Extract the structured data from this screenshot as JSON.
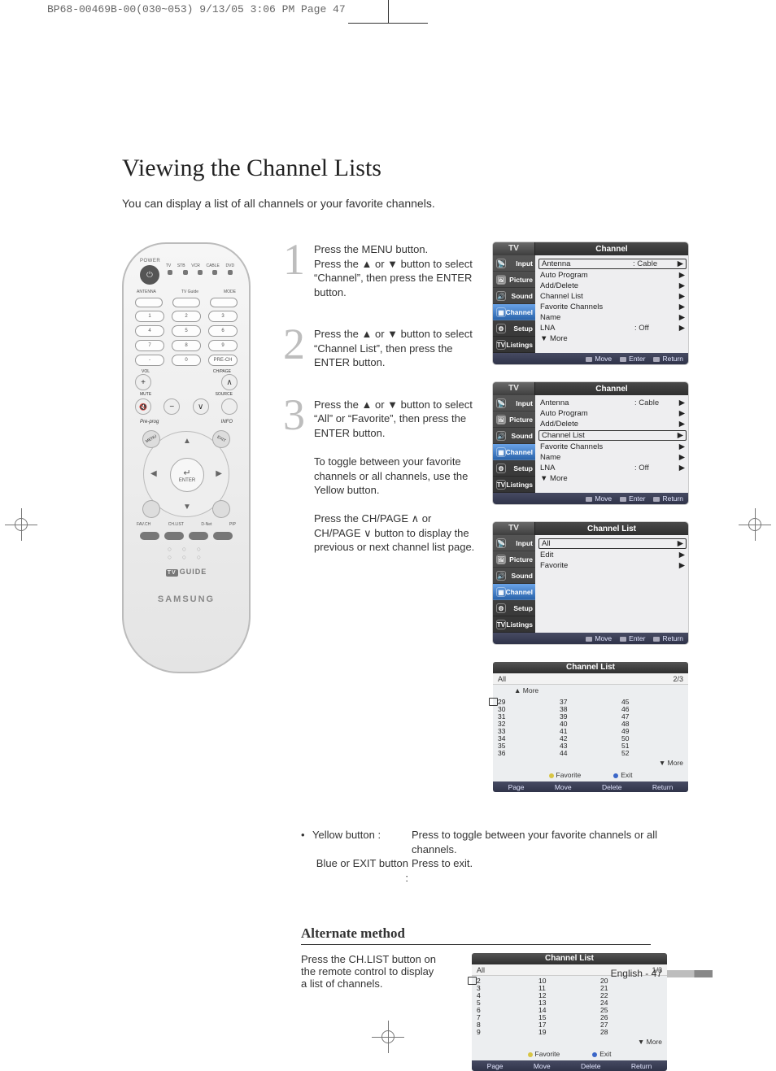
{
  "print_header": "BP68-00469B-00(030~053)  9/13/05  3:06 PM  Page 47",
  "title": "Viewing the Channel Lists",
  "intro": "You can display a list of all channels or your favorite channels.",
  "remote": {
    "power_label": "POWER",
    "mode_labels": [
      "TV",
      "STB",
      "VCR",
      "CABLE",
      "DVD"
    ],
    "row1_labels": [
      "ANTENNA",
      "TV Guide",
      "MODE"
    ],
    "numbers": [
      "1",
      "2",
      "3",
      "4",
      "5",
      "6",
      "7",
      "8",
      "9",
      "-",
      "0"
    ],
    "prech": "PRE-CH",
    "vol": "VOL",
    "chpage": "CH/PAGE",
    "mute": "MUTE",
    "source": "SOURCE",
    "corner_tl": "MENU",
    "corner_tr": "EXIT",
    "corner_bl": "",
    "corner_br": "",
    "preprog": "Pre-prog",
    "info": "INFO",
    "enter_icon": "↵",
    "enter_label": "ENTER",
    "bottom_row": [
      "FAV.CH",
      "CH.LIST",
      "D-Net",
      "PIP"
    ],
    "tvguide": "GUIDE",
    "tvguide_prefix": "TV",
    "brand": "SAMSUNG"
  },
  "steps": [
    {
      "num": "1",
      "text": "Press the MENU button.\nPress the ▲ or ▼ button to select “Channel”, then press the ENTER button."
    },
    {
      "num": "2",
      "text": "Press the ▲ or ▼ button to select “Channel List”, then press the ENTER button."
    },
    {
      "num": "3",
      "text": "Press the ▲ or ▼ button to select “All” or “Favorite”, then press the ENTER button.\n\nTo toggle between your favorite channels or all channels, use the Yellow button.\n\nPress the CH/PAGE ∧ or CH/PAGE ∨ button to display the previous or next channel list page."
    }
  ],
  "notes": {
    "yellow_label": "Yellow button :",
    "yellow_text": "Press to toggle between your favorite channels or all channels.",
    "blue_label": "Blue or EXIT button :",
    "blue_text": "Press to exit."
  },
  "alt": {
    "heading": "Alternate method",
    "text": "Press the CH.LIST button on the remote control to display a list of channels."
  },
  "osd_common": {
    "tv_label": "TV",
    "side_items": [
      "Input",
      "Picture",
      "Sound",
      "Channel",
      "Setup",
      "Listings"
    ],
    "foot": [
      "Move",
      "Enter",
      "Return"
    ]
  },
  "osd1": {
    "title": "Channel",
    "selected_side": "Channel",
    "boxed": "Antenna",
    "rows": [
      {
        "name": "Antenna",
        "val": ": Cable",
        "ar": "▶"
      },
      {
        "name": "Auto Program",
        "val": "",
        "ar": "▶"
      },
      {
        "name": "Add/Delete",
        "val": "",
        "ar": "▶"
      },
      {
        "name": "Channel List",
        "val": "",
        "ar": "▶"
      },
      {
        "name": "Favorite Channels",
        "val": "",
        "ar": "▶"
      },
      {
        "name": "Name",
        "val": "",
        "ar": "▶"
      },
      {
        "name": "LNA",
        "val": ": Off",
        "ar": "▶"
      },
      {
        "name": "▼ More",
        "val": "",
        "ar": ""
      }
    ]
  },
  "osd2": {
    "title": "Channel",
    "selected_side": "Channel",
    "boxed": "Channel List",
    "rows": [
      {
        "name": "Antenna",
        "val": ": Cable",
        "ar": "▶"
      },
      {
        "name": "Auto Program",
        "val": "",
        "ar": "▶"
      },
      {
        "name": "Add/Delete",
        "val": "",
        "ar": "▶"
      },
      {
        "name": "Channel List",
        "val": "",
        "ar": "▶"
      },
      {
        "name": "Favorite Channels",
        "val": "",
        "ar": "▶"
      },
      {
        "name": "Name",
        "val": "",
        "ar": "▶"
      },
      {
        "name": "LNA",
        "val": ": Off",
        "ar": "▶"
      },
      {
        "name": "▼ More",
        "val": "",
        "ar": ""
      }
    ]
  },
  "osd3": {
    "title": "Channel List",
    "selected_side": "Channel",
    "boxed": "All",
    "rows": [
      {
        "name": "All",
        "val": "",
        "ar": "▶"
      },
      {
        "name": "Edit",
        "val": "",
        "ar": "▶"
      },
      {
        "name": "Favorite",
        "val": "",
        "ar": "▶"
      }
    ]
  },
  "chlist1": {
    "title": "Channel List",
    "tab": "All",
    "page": "2/3",
    "more_top": "▲ More",
    "more_bottom": "▼ More",
    "cols": [
      [
        "29",
        "30",
        "31",
        "32",
        "33",
        "34",
        "35",
        "36"
      ],
      [
        "37",
        "38",
        "39",
        "40",
        "41",
        "42",
        "43",
        "44"
      ],
      [
        "45",
        "46",
        "47",
        "48",
        "49",
        "50",
        "51",
        "52"
      ]
    ],
    "legend": {
      "yellow": "Favorite",
      "blue": "Exit"
    },
    "foot": [
      "Page",
      "Move",
      "Delete",
      "Return"
    ]
  },
  "chlist2": {
    "title": "Channel List",
    "tab": "All",
    "page": "1/3",
    "more_bottom": "▼ More",
    "cols": [
      [
        "2",
        "3",
        "4",
        "5",
        "6",
        "7",
        "8",
        "9"
      ],
      [
        "10",
        "11",
        "12",
        "13",
        "14",
        "15",
        "17",
        "19"
      ],
      [
        "20",
        "21",
        "22",
        "24",
        "25",
        "26",
        "27",
        "28"
      ]
    ],
    "legend": {
      "yellow": "Favorite",
      "blue": "Exit"
    },
    "foot": [
      "Page",
      "Move",
      "Delete",
      "Return"
    ]
  },
  "footer": {
    "lang": "English -",
    "page": "47"
  }
}
